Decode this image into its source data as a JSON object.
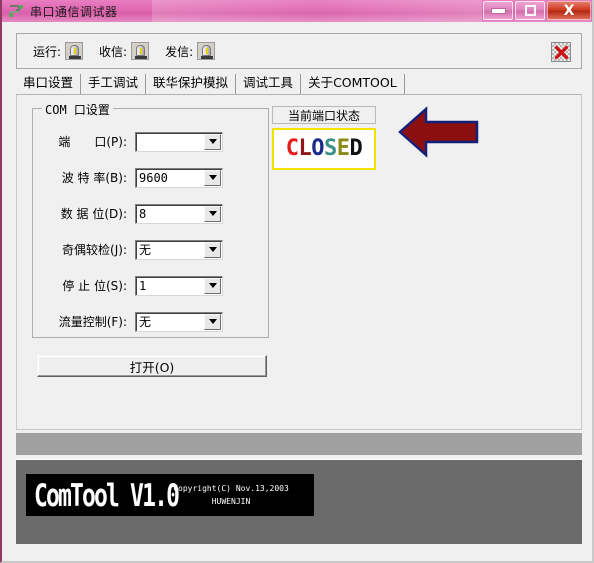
{
  "window": {
    "title": "串口通信调试器",
    "icon": "serial-port-icon",
    "controls": {
      "minimize": "minimize-icon",
      "maximize": "maximize-icon",
      "close": "X"
    }
  },
  "toolbar": {
    "items": [
      {
        "label": "运行:",
        "icon": "led-lamp-icon"
      },
      {
        "label": "收信:",
        "icon": "led-lamp-icon"
      },
      {
        "label": "发信:",
        "icon": "led-lamp-icon"
      }
    ],
    "close_icon": "red-x-icon"
  },
  "tabs": [
    {
      "label": "串口设置",
      "active": true
    },
    {
      "label": "手工调试",
      "active": false
    },
    {
      "label": "联华保护模拟",
      "active": false
    },
    {
      "label": "调试工具",
      "active": false
    },
    {
      "label": "关于COMTOOL",
      "active": false
    }
  ],
  "com_settings": {
    "group_title": "COM 口设置",
    "fields": [
      {
        "label": "端　　口(P):",
        "value": ""
      },
      {
        "label": "波 特 率(B):",
        "value": "9600"
      },
      {
        "label": "数 据 位(D):",
        "value": "8"
      },
      {
        "label": "奇偶较检(J):",
        "value": "无"
      },
      {
        "label": "停 止 位(S):",
        "value": "1"
      },
      {
        "label": "流量控制(F):",
        "value": "无"
      }
    ],
    "open_button": "打开(O)"
  },
  "port_status": {
    "panel_label": "当前端口状态",
    "value": "CLOSED",
    "letters": [
      {
        "char": "C",
        "color": "#e81b1b"
      },
      {
        "char": "L",
        "color": "#8f1616"
      },
      {
        "char": "O",
        "color": "#1c2a8c"
      },
      {
        "char": "S",
        "color": "#3a8f8a"
      },
      {
        "char": "E",
        "color": "#8a8a16"
      },
      {
        "char": "D",
        "color": "#111111"
      }
    ],
    "border_color": "#f2e300"
  },
  "annotation": {
    "arrow": "left-arrow-annotation",
    "fill_color": "#8b0f0f",
    "outline_color": "#14207a"
  },
  "banner": {
    "logo": "ComTool V1.0",
    "copyright": "Copyright(C) Nov.13,2003",
    "author": "HUWENJIN"
  },
  "colors": {
    "titlebar": "#e06bb4",
    "window_bg": "#f0f0f0",
    "gray_strip": "#a0a0a0",
    "bottom_panel": "#6b6b6b"
  }
}
